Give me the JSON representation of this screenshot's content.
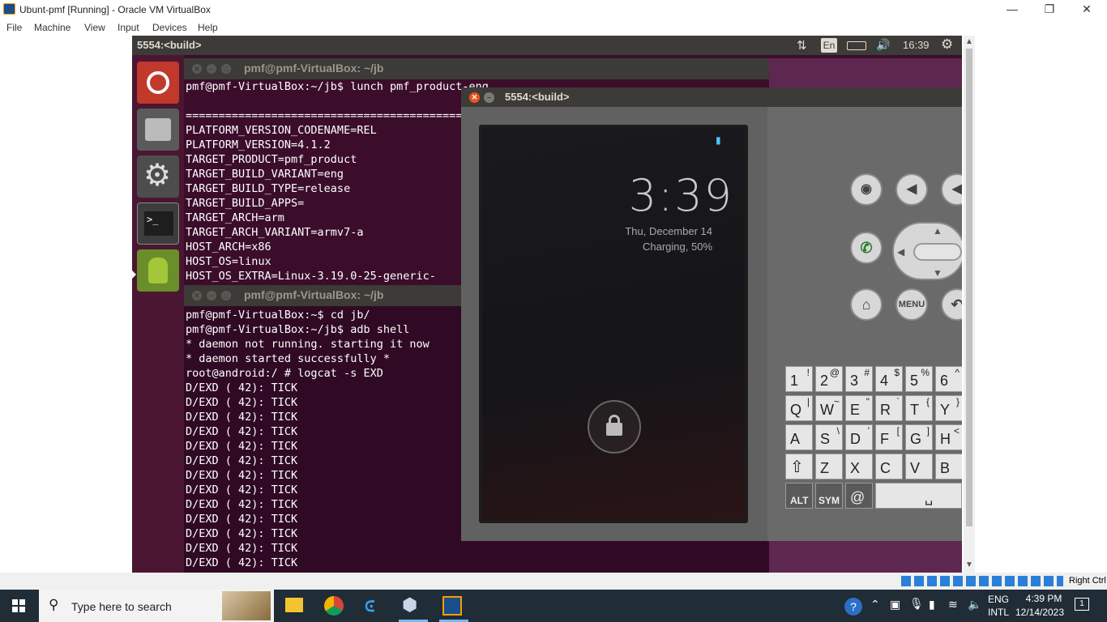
{
  "window": {
    "title": "Ubunt-pmf [Running] - Oracle VM VirtualBox",
    "menu": [
      "File",
      "Machine",
      "View",
      "Input",
      "Devices",
      "Help"
    ],
    "host_key": "Right Ctrl"
  },
  "guest": {
    "topbar": {
      "title": "5554:<build>",
      "lang": "En",
      "time": "16:39"
    },
    "terminal1": {
      "title": "pmf@pmf-VirtualBox: ~/jb",
      "lines": [
        "pmf@pmf-VirtualBox:~/jb$ lunch pmf_product-eng",
        "",
        "============================================",
        "PLATFORM_VERSION_CODENAME=REL",
        "PLATFORM_VERSION=4.1.2",
        "TARGET_PRODUCT=pmf_product",
        "TARGET_BUILD_VARIANT=eng",
        "TARGET_BUILD_TYPE=release",
        "TARGET_BUILD_APPS=",
        "TARGET_ARCH=arm",
        "TARGET_ARCH_VARIANT=armv7-a",
        "HOST_ARCH=x86",
        "HOST_OS=linux",
        "HOST_OS_EXTRA=Linux-3.19.0-25-generic-"
      ]
    },
    "terminal2": {
      "title": "pmf@pmf-VirtualBox: ~/jb",
      "lines": [
        "pmf@pmf-VirtualBox:~$ cd jb/",
        "pmf@pmf-VirtualBox:~/jb$ adb shell",
        "* daemon not running. starting it now",
        "* daemon started successfully *",
        "root@android:/ # logcat -s EXD",
        "D/EXD     (   42): TICK",
        "D/EXD     (   42): TICK",
        "D/EXD     (   42): TICK",
        "D/EXD     (   42): TICK",
        "D/EXD     (   42): TICK",
        "D/EXD     (   42): TICK",
        "D/EXD     (   42): TICK",
        "D/EXD     (   42): TICK",
        "D/EXD     (   42): TICK",
        "D/EXD     (   42): TICK",
        "D/EXD     (   42): TICK",
        "D/EXD     (   42): TICK",
        "D/EXD     (   42): TICK"
      ]
    },
    "emulator": {
      "title": "5554:<build>",
      "clock": "3:39",
      "date": "Thu, December 14",
      "charging": "Charging, 50%",
      "menu_label": "MENU",
      "keyboard": {
        "row1": [
          [
            "1",
            "!"
          ],
          [
            "2",
            "@"
          ],
          [
            "3",
            "#"
          ],
          [
            "4",
            "$"
          ],
          [
            "5",
            "%"
          ],
          [
            "6",
            "^"
          ]
        ],
        "row2": [
          [
            "Q",
            "|"
          ],
          [
            "W",
            "~"
          ],
          [
            "E",
            "\""
          ],
          [
            "R",
            "`"
          ],
          [
            "T",
            "{"
          ],
          [
            "Y",
            "}"
          ]
        ],
        "row3": [
          [
            "A",
            ""
          ],
          [
            "S",
            "\\"
          ],
          [
            "D",
            "'"
          ],
          [
            "F",
            "["
          ],
          [
            "G",
            "]"
          ],
          [
            "H",
            "<"
          ]
        ],
        "row4": [
          [
            "Z",
            ""
          ],
          [
            "X",
            ""
          ],
          [
            "C",
            ""
          ],
          [
            "V",
            ""
          ],
          [
            "B",
            ""
          ]
        ],
        "alt": "ALT",
        "sym": "SYM",
        "at": "@"
      }
    }
  },
  "taskbar": {
    "search_placeholder": "Type here to search",
    "lang_top": "ENG",
    "lang_bottom": "INTL",
    "time": "4:39 PM",
    "date": "12/14/2023",
    "notifications": "1"
  }
}
